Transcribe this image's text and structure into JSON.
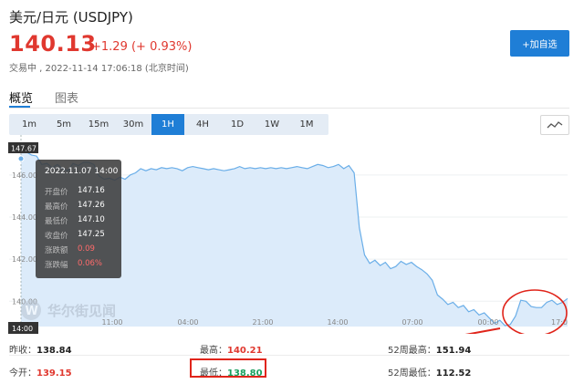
{
  "header": {
    "title": "美元/日元 (USDJPY)",
    "price": "140.13",
    "change": "+1.29 (+ 0.93%)",
    "status": "交易中 , 2022-11-14 17:06:18 (北京时间)",
    "add_button": "+加自选"
  },
  "tabs": {
    "overview": "概览",
    "chart": "图表"
  },
  "periods": [
    "1m",
    "5m",
    "15m",
    "30m",
    "1H",
    "4H",
    "1D",
    "1W",
    "1M"
  ],
  "active_period": "1H",
  "chart_data": {
    "type": "area",
    "title": "",
    "xlabel": "",
    "ylabel": "",
    "x_tick_labels": [
      "11:00",
      "04:00",
      "21:00",
      "14:00",
      "07:00",
      "00:00",
      "17:0"
    ],
    "y_tick_labels": [
      "146.00",
      "144.00",
      "142.00",
      "140.00"
    ],
    "ylim": [
      138.8,
      147.9
    ],
    "values": [
      147.25,
      147.1,
      146.95,
      146.9,
      146.5,
      146.55,
      146.35,
      146.5,
      146.3,
      146.2,
      146.55,
      146.45,
      146.6,
      146.6,
      146.5,
      145.95,
      145.8,
      145.85,
      145.75,
      145.9,
      145.8,
      146.0,
      146.1,
      146.3,
      146.2,
      146.3,
      146.25,
      146.35,
      146.3,
      146.35,
      146.3,
      146.2,
      146.35,
      146.4,
      146.35,
      146.3,
      146.25,
      146.3,
      146.25,
      146.2,
      146.25,
      146.3,
      146.4,
      146.3,
      146.35,
      146.3,
      146.35,
      146.3,
      146.35,
      146.3,
      146.35,
      146.3,
      146.35,
      146.4,
      146.35,
      146.3,
      146.4,
      146.5,
      146.45,
      146.35,
      146.4,
      146.5,
      146.3,
      146.45,
      146.1,
      143.5,
      142.2,
      141.8,
      141.95,
      141.7,
      141.85,
      141.55,
      141.65,
      141.9,
      141.75,
      141.85,
      141.65,
      141.5,
      141.3,
      141.0,
      140.3,
      140.1,
      139.85,
      139.95,
      139.7,
      139.8,
      139.5,
      139.6,
      139.35,
      139.45,
      139.2,
      138.95,
      139.1,
      138.84,
      138.9,
      139.3,
      140.05,
      140.0,
      139.75,
      139.7,
      139.7,
      139.95,
      140.05,
      139.85,
      139.95,
      140.13
    ],
    "cursor_value": "147.67",
    "cursor_time_label": "14:00",
    "watermark": "华尔街见闻"
  },
  "tooltip": {
    "date": "2022.11.07 14:00",
    "rows": [
      {
        "key": "开盘价",
        "value": "147.16"
      },
      {
        "key": "最高价",
        "value": "147.26"
      },
      {
        "key": "最低价",
        "value": "147.10"
      },
      {
        "key": "收盘价",
        "value": "147.25"
      },
      {
        "key": "涨跌额",
        "value": "0.09"
      },
      {
        "key": "涨跌幅",
        "value": "0.06%"
      }
    ]
  },
  "stats": {
    "prev_close_label": "昨收：",
    "prev_close": "138.84",
    "high_label": "最高：",
    "high": "140.21",
    "w52_high_label": "52周最高：",
    "w52_high": "151.94",
    "open_label": "今开：",
    "open": "139.15",
    "low_label": "最低：",
    "low": "138.80",
    "w52_low_label": "52周最低：",
    "w52_low": "112.52"
  },
  "colors": {
    "up": "#e0382f",
    "down": "#19a15f",
    "accent": "#1f7ed6",
    "annotation": "#e0241a"
  }
}
